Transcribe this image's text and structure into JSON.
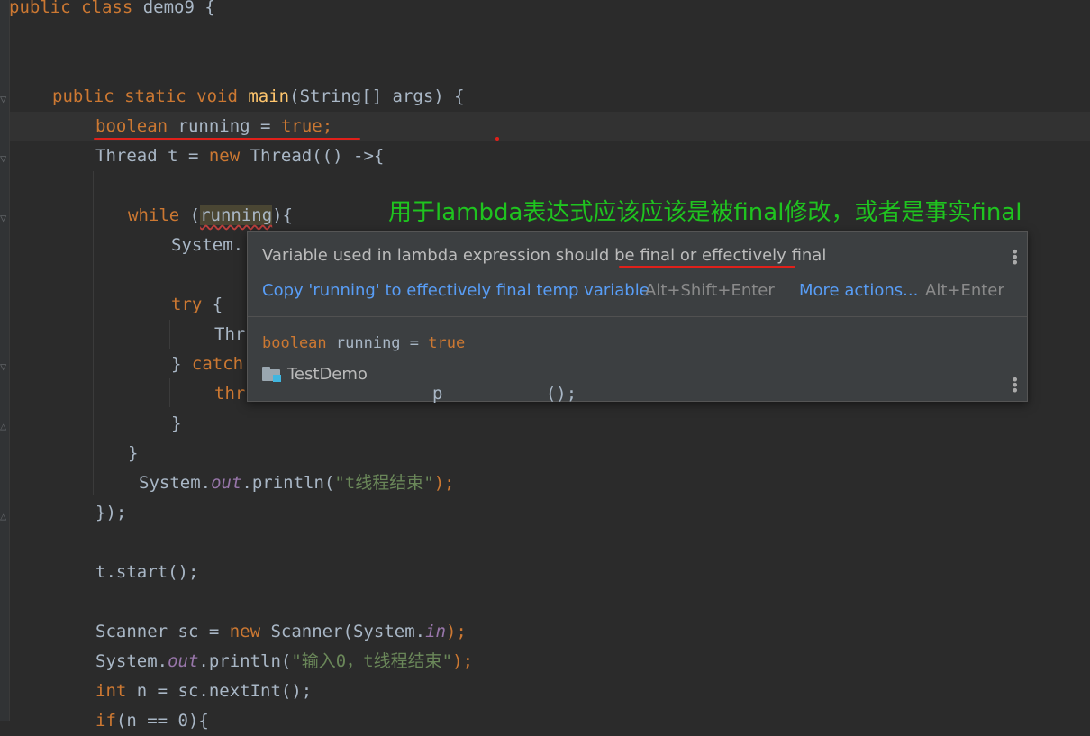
{
  "code": {
    "class_decl": {
      "kw": "public class",
      "name": " demo9 {"
    },
    "main_decl": {
      "kw": "public static void",
      "fn": "main",
      "rest": "(String[] args) {"
    },
    "decl_line": {
      "kw": "boolean",
      "var": "running",
      "eq": " = ",
      "val": "true",
      "semi": ";"
    },
    "thread_line": {
      "pre": "Thread t = ",
      "kw": "new",
      "post": " Thread(() ->{"
    },
    "while_line": {
      "kw": "while",
      "open": " (",
      "var": "running",
      "close": "){"
    },
    "system_partial": "System.",
    "try_line": {
      "kw": "try",
      "post": " {"
    },
    "thr_partial": "Thr",
    "catch_line": {
      "pre": "} ",
      "kw": "catch"
    },
    "throw_partial": "thr",
    "throw_tail": "p          ();",
    "brace_close_inner": "}",
    "brace_close_while": "}",
    "println1": {
      "pre": "System.",
      "fld": "out",
      "mid": ".println(",
      "str": "\"t线程结束\"",
      "semi": ");"
    },
    "lambda_close": {
      "pre": "});",
      "semi": ""
    },
    "start_line": "t.start();",
    "scanner_line": {
      "pre": "Scanner sc = ",
      "kw": "new",
      "mid": " Scanner(System.",
      "fld": "in",
      "end": ");"
    },
    "println2": {
      "pre": "System.",
      "fld": "out",
      "mid": ".println(",
      "str": "\"输入0，t线程结束\"",
      "end": ");"
    },
    "int_line": {
      "kw": "int",
      "post": " n = sc.nextInt();"
    },
    "if_line": {
      "kw": "if",
      "post": "(n == 0){"
    }
  },
  "annotation": "用于lambda表达式应该应该是被final修改，或者是事实final",
  "popup": {
    "message_pre": "Variable used in lambda expression should be ",
    "message_final1": "final",
    "message_mid": " or effectively ",
    "message_final2": "final",
    "fix_action": "Copy 'running' to effectively final temp variable",
    "fix_shortcut": "Alt+Shift+Enter",
    "more_actions": "More actions...",
    "more_shortcut": "Alt+Enter",
    "decl_kw": "boolean",
    "decl_var": " running = ",
    "decl_val": "true",
    "project": "TestDemo"
  },
  "colors": {
    "editor_bg": "#2b2b2b",
    "keyword": "#cc7832",
    "string": "#6a8759",
    "function": "#ffc66d",
    "field": "#9876aa",
    "annotation_text": "#1fc41f",
    "red_mark": "#e0201a",
    "link": "#589df6"
  }
}
